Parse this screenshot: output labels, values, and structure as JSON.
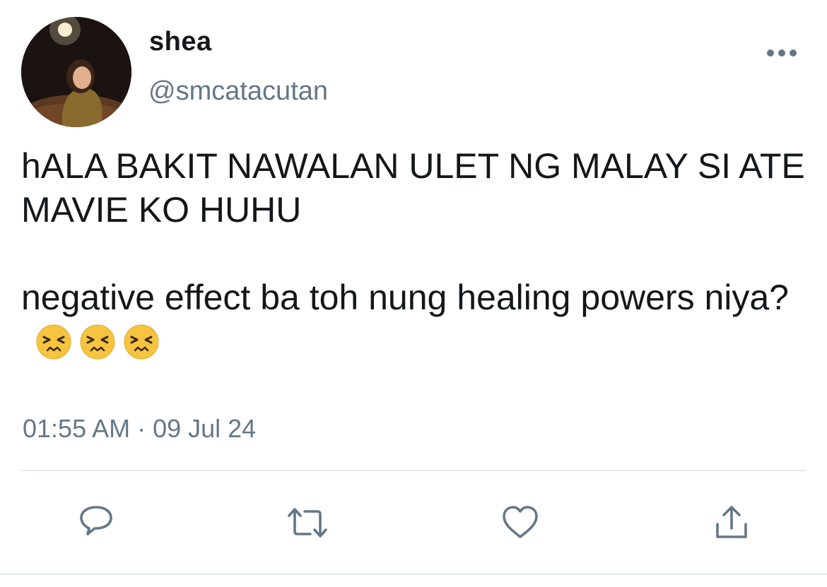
{
  "author": {
    "display_name": "shea",
    "handle": "@smcatacutan"
  },
  "tweet": {
    "paragraph_1": "hALA BAKIT NAWALAN ULET NG MALAY SI ATE MAVIE KO HUHU",
    "paragraph_2": "negative effect ba toh nung healing powers niya?",
    "emojis": [
      "persevering-face",
      "persevering-face",
      "persevering-face"
    ]
  },
  "timestamp": "01:55 AM · 09 Jul 24",
  "actions": {
    "reply_icon": "speech-bubble-icon",
    "retweet_icon": "retweet-icon",
    "like_icon": "heart-icon",
    "share_icon": "share-icon"
  },
  "colors": {
    "text": "#14171a",
    "secondary": "#657786",
    "divider": "#e1e8ed",
    "emoji_face": "#f7c440"
  }
}
